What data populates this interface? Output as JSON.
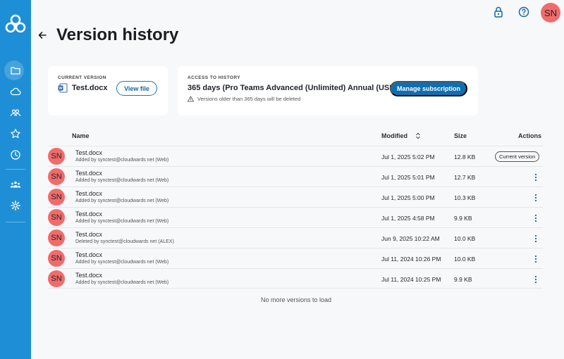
{
  "colors": {
    "sidebar": "#1e8fd6",
    "accent": "#0e6fb0",
    "avatar": "#f26b6b"
  },
  "sidebar": {
    "items": [
      {
        "icon": "folder-icon",
        "active": true
      },
      {
        "icon": "cloud-icon"
      },
      {
        "icon": "people-icon"
      },
      {
        "icon": "star-icon"
      },
      {
        "icon": "clock-icon"
      },
      {
        "icon": "team-icon"
      },
      {
        "icon": "gear-icon"
      }
    ]
  },
  "header": {
    "avatar_initials": "SN",
    "title": "Version history",
    "icons": [
      "lock-icon",
      "help-icon"
    ]
  },
  "current_version": {
    "caption": "CURRENT VERSION",
    "file_name": "Test.docx",
    "button": "View file"
  },
  "access": {
    "caption": "ACCESS TO HISTORY",
    "plan": "365 days (Pro Teams Advanced (Unlimited) Annual (USD))",
    "warning": "Versions older than 365 days will be deleted",
    "button": "Manage subscription"
  },
  "table": {
    "headers": {
      "name": "Name",
      "modified": "Modified",
      "size": "Size",
      "actions": "Actions"
    },
    "rows": [
      {
        "initials": "SN",
        "name": "Test.docx",
        "sub": "Added by synctest@cloudwards net (Web)",
        "modified": "Jul 1, 2025 5:02 PM",
        "size": "12.8 KB",
        "badge": "Current version"
      },
      {
        "initials": "SN",
        "name": "Test.docx",
        "sub": "Added by synctest@cloudwards net (Web)",
        "modified": "Jul 1, 2025 5:01 PM",
        "size": "12.7 KB"
      },
      {
        "initials": "SN",
        "name": "Test.docx",
        "sub": "Added by synctest@cloudwards net (Web)",
        "modified": "Jul 1, 2025 5:00 PM",
        "size": "10.3 KB"
      },
      {
        "initials": "SN",
        "name": "Test.docx",
        "sub": "Added by synctest@cloudwards net (Web)",
        "modified": "Jul 1, 2025 4:58 PM",
        "size": "9.9 KB"
      },
      {
        "initials": "SN",
        "name": "Test.docx",
        "sub": "Deleted by synctest@cloudwards net (ALEX)",
        "modified": "Jun 9, 2025 10:22 AM",
        "size": "10.0 KB"
      },
      {
        "initials": "SN",
        "name": "Test.docx",
        "sub": "Added by synctest@cloudwards net (Web)",
        "modified": "Jul 11, 2024 10:26 PM",
        "size": "10.0 KB"
      },
      {
        "initials": "SN",
        "name": "Test.docx",
        "sub": "Added by synctest@cloudwards net (Web)",
        "modified": "Jul 11, 2024 10:25 PM",
        "size": "9.9 KB"
      }
    ],
    "footer": "No more versions to load"
  }
}
